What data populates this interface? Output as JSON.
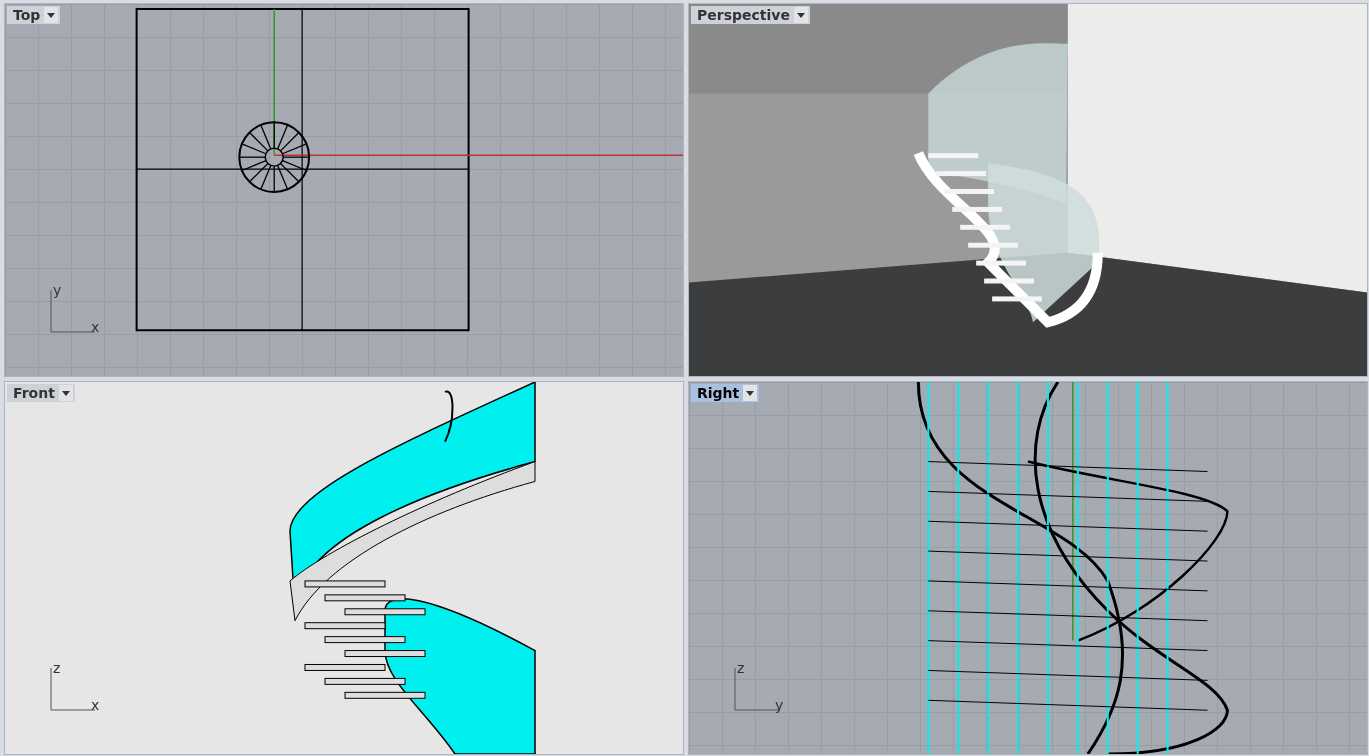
{
  "viewports": [
    {
      "title": "Top",
      "kind": "top",
      "selected": false,
      "axes": {
        "vertical": "y",
        "horizontal": "x"
      }
    },
    {
      "title": "Perspective",
      "kind": "perspective",
      "selected": false
    },
    {
      "title": "Front",
      "kind": "front",
      "selected": false,
      "axes": {
        "vertical": "z",
        "horizontal": "x"
      }
    },
    {
      "title": "Right",
      "kind": "right",
      "selected": true,
      "axes": {
        "vertical": "z",
        "horizontal": "y"
      }
    }
  ]
}
